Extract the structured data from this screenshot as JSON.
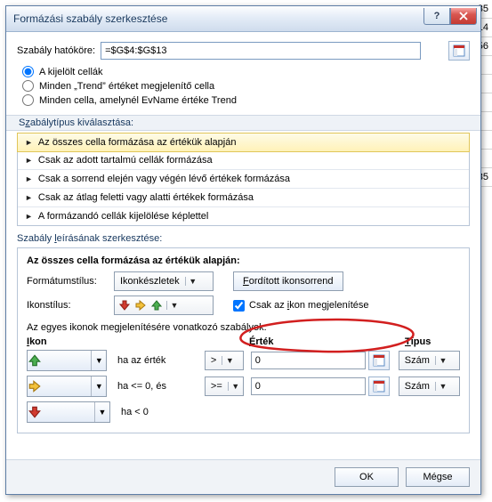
{
  "bg_cells": [
    "35",
    "14",
    "56",
    "",
    "",
    "",
    "",
    "",
    "",
    "35"
  ],
  "dialog": {
    "title": "Formázási szabály szerkesztése",
    "scope_label": "Szabály hatóköre:",
    "scope_value": "=$G$4:$G$13",
    "radios": {
      "r1": "A kijelölt cellák",
      "r2": "Minden „Trend” értéket megjelenítő cella",
      "r3": "Minden cella, amelynél EvName értéke Trend"
    },
    "ruletype_head": "Szabálytípus kiválasztása:",
    "ruletypes": [
      "Az összes cella formázása az értékük alapján",
      "Csak az adott tartalmú cellák formázása",
      "Csak a sorrend elején vagy végén lévő értékek formázása",
      "Csak az átlag feletti vagy alatti értékek formázása",
      "A formázandó cellák kijelölése képlettel"
    ],
    "desc_head": "Szabály leírásának szerkesztése:",
    "panel": {
      "title": "Az összes cella formázása az értékük alapján:",
      "format_label": "Formátumstílus:",
      "format_value": "Ikonkészletek",
      "reverse_btn": "Fordított ikonsorrend",
      "iconstyle_label": "Ikonstílus:",
      "iconshow_only": "Csak az ikon megjelenítése",
      "rules_sub": "Az egyes ikonok megjelenítésére vonatkozó szabályok:",
      "col_icon": "Ikon",
      "col_value": "Érték",
      "col_type": "Típus",
      "rows": [
        {
          "mid": "ha az érték",
          "op": ">",
          "val": "0",
          "type": "Szám"
        },
        {
          "mid": "ha <= 0, és",
          "op": ">=",
          "val": "0",
          "type": "Szám"
        },
        {
          "mid": "ha < 0"
        }
      ]
    },
    "ok": "OK",
    "cancel": "Mégse"
  }
}
